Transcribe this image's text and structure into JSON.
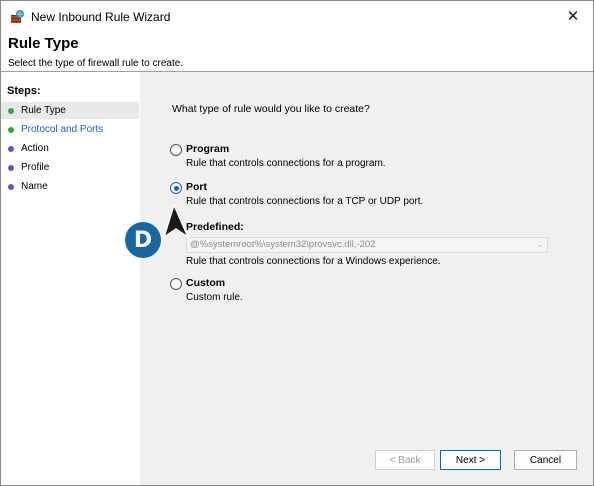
{
  "window": {
    "title": "New Inbound Rule Wizard",
    "close_glyph": "✕"
  },
  "header": {
    "title": "Rule Type",
    "subtitle": "Select the type of firewall rule to create."
  },
  "sidebar": {
    "steps_title": "Steps:",
    "items": [
      {
        "label": "Rule Type",
        "status": "green",
        "active": true,
        "link": false
      },
      {
        "label": "Protocol and Ports",
        "status": "green",
        "active": false,
        "link": true
      },
      {
        "label": "Action",
        "status": "blue",
        "active": false,
        "link": false
      },
      {
        "label": "Profile",
        "status": "blue",
        "active": false,
        "link": false
      },
      {
        "label": "Name",
        "status": "blue",
        "active": false,
        "link": false
      }
    ]
  },
  "main": {
    "question": "What type of rule would you like to create?",
    "options": [
      {
        "title": "Program",
        "description": "Rule that controls connections for a program.",
        "checked": false
      },
      {
        "title": "Port",
        "description": "Rule that controls connections for a TCP or UDP port.",
        "checked": true
      },
      {
        "title": "Custom",
        "description": "Custom rule.",
        "checked": false
      }
    ],
    "predefined": {
      "label": "Predefined:",
      "value": "@%systemroot%\\system32\\provsvc.dll,-202",
      "description": "Rule that controls connections for a Windows experience."
    }
  },
  "buttons": {
    "back": "< Back",
    "next": "Next >",
    "cancel": "Cancel"
  },
  "annotation": {
    "badge_letter": "D"
  },
  "colors": {
    "accent": "#1565c0",
    "step_done": "#35a635",
    "step_pending": "#5a5acd",
    "link": "#1a5cc7",
    "content_bg": "#f0f0f0"
  }
}
